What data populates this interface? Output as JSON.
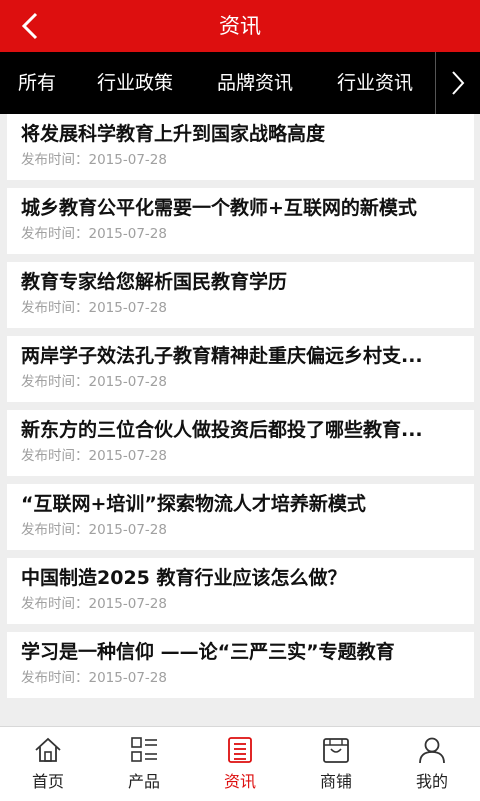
{
  "header": {
    "title": "资讯"
  },
  "tabs": [
    "所有",
    "行业政策",
    "品牌资讯",
    "行业资讯"
  ],
  "date_prefix": "发布时间：",
  "articles": [
    {
      "title": "将发展科学教育上升到国家战略高度",
      "date": "2015-07-28"
    },
    {
      "title": "城乡教育公平化需要一个教师+互联网的新模式",
      "date": "2015-07-28"
    },
    {
      "title": "教育专家给您解析国民教育学历",
      "date": "2015-07-28"
    },
    {
      "title": "两岸学子效法孔子教育精神赴重庆偏远乡村支...",
      "date": "2015-07-28"
    },
    {
      "title": "新东方的三位合伙人做投资后都投了哪些教育...",
      "date": "2015-07-28"
    },
    {
      "title": "“互联网+培训”探索物流人才培养新模式",
      "date": "2015-07-28"
    },
    {
      "title": "中国制造2025 教育行业应该怎么做？",
      "date": "2015-07-28"
    },
    {
      "title": "学习是一种信仰 ——论“三严三实”专题教育",
      "date": "2015-07-28"
    }
  ],
  "bottom_nav": [
    {
      "label": "首页",
      "icon": "home-icon"
    },
    {
      "label": "产品",
      "icon": "grid-list-icon"
    },
    {
      "label": "资讯",
      "icon": "news-icon",
      "active": true
    },
    {
      "label": "商铺",
      "icon": "store-icon"
    },
    {
      "label": "我的",
      "icon": "user-icon"
    }
  ],
  "colors": {
    "accent": "#dd0f0f",
    "tabbar": "#000000",
    "background": "#eeeeee"
  }
}
